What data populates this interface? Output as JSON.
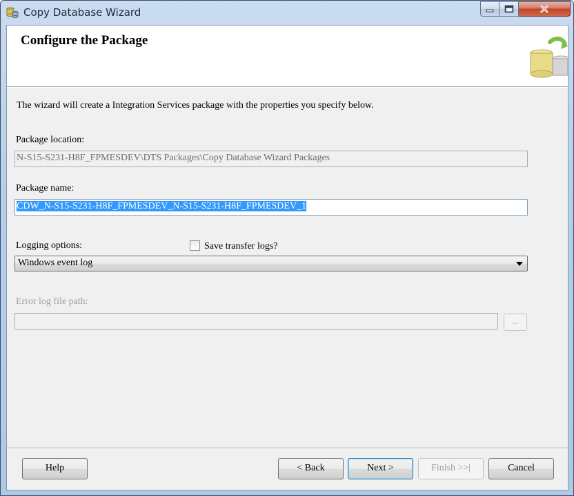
{
  "window": {
    "title": "Copy Database Wizard",
    "controls": {
      "minimize": "minimize",
      "maximize": "maximize",
      "close": "close"
    }
  },
  "header": {
    "title": "Configure the Package",
    "art_icon": "database-copy-icon"
  },
  "description": "The wizard will create a Integration Services package with the properties you specify below.",
  "package_location": {
    "label": "Package location:",
    "value": "N-S15-S231-H8F_FPMESDEV\\DTS Packages\\Copy Database Wizard Packages"
  },
  "package_name": {
    "label": "Package name:",
    "value": "CDW_N-S15-S231-H8F_FPMESDEV_N-S15-S231-H8F_FPMESDEV_1"
  },
  "logging": {
    "label": "Logging options:",
    "selected": "Windows event log",
    "save_logs_label": "Save transfer logs?",
    "save_logs_checked": false
  },
  "error_log": {
    "label": "Error log file path:",
    "value": "",
    "browse_label": "..."
  },
  "buttons": {
    "help": "Help",
    "back": "< Back",
    "next": "Next >",
    "finish": "Finish >>|",
    "cancel": "Cancel"
  }
}
